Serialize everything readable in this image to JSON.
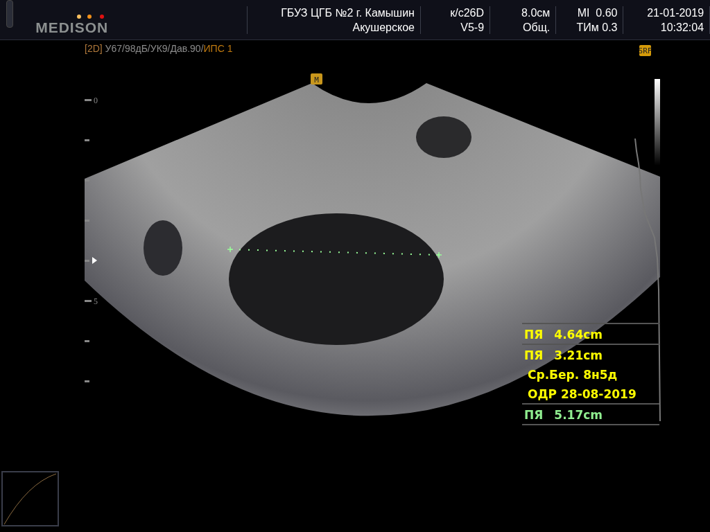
{
  "header": {
    "logo": "MEDISON",
    "institution": "ГБУЗ ЦГБ №2 г. Камышин",
    "preset": "Акушерское",
    "info_columns": [
      {
        "top": "к/с26D",
        "bottom": "V5-9"
      },
      {
        "top": "8.0см",
        "bottom": "Общ."
      },
      {
        "top": "MI  0.60",
        "bottom": "ТИм 0.3"
      },
      {
        "top": "21-01-2019",
        "bottom": "10:32:04"
      }
    ]
  },
  "status_line": {
    "mode": "[2D]",
    "parameters": "У67/98дБ/УК9/Дав.90/",
    "filter": "ИПС 1"
  },
  "badge": "SRF",
  "orientation_marker": "M",
  "depth_scale": {
    "labels": [
      "0",
      "5"
    ]
  },
  "measurements": [
    {
      "kind": "measurement",
      "label": "ПЯ",
      "value": "4.64cm",
      "color": "#ffff00"
    },
    {
      "kind": "measurement",
      "label": "ПЯ",
      "value": "3.21cm",
      "color": "#ffff00"
    },
    {
      "kind": "calculation",
      "text": "Ср.Бер. 8н5д",
      "color": "#ffff00"
    },
    {
      "kind": "calculation",
      "text": "ОДР 28-08-2019",
      "color": "#ffff00"
    },
    {
      "kind": "measurement",
      "label": "ПЯ",
      "value": "5.17cm",
      "color": "#90ee90"
    }
  ]
}
